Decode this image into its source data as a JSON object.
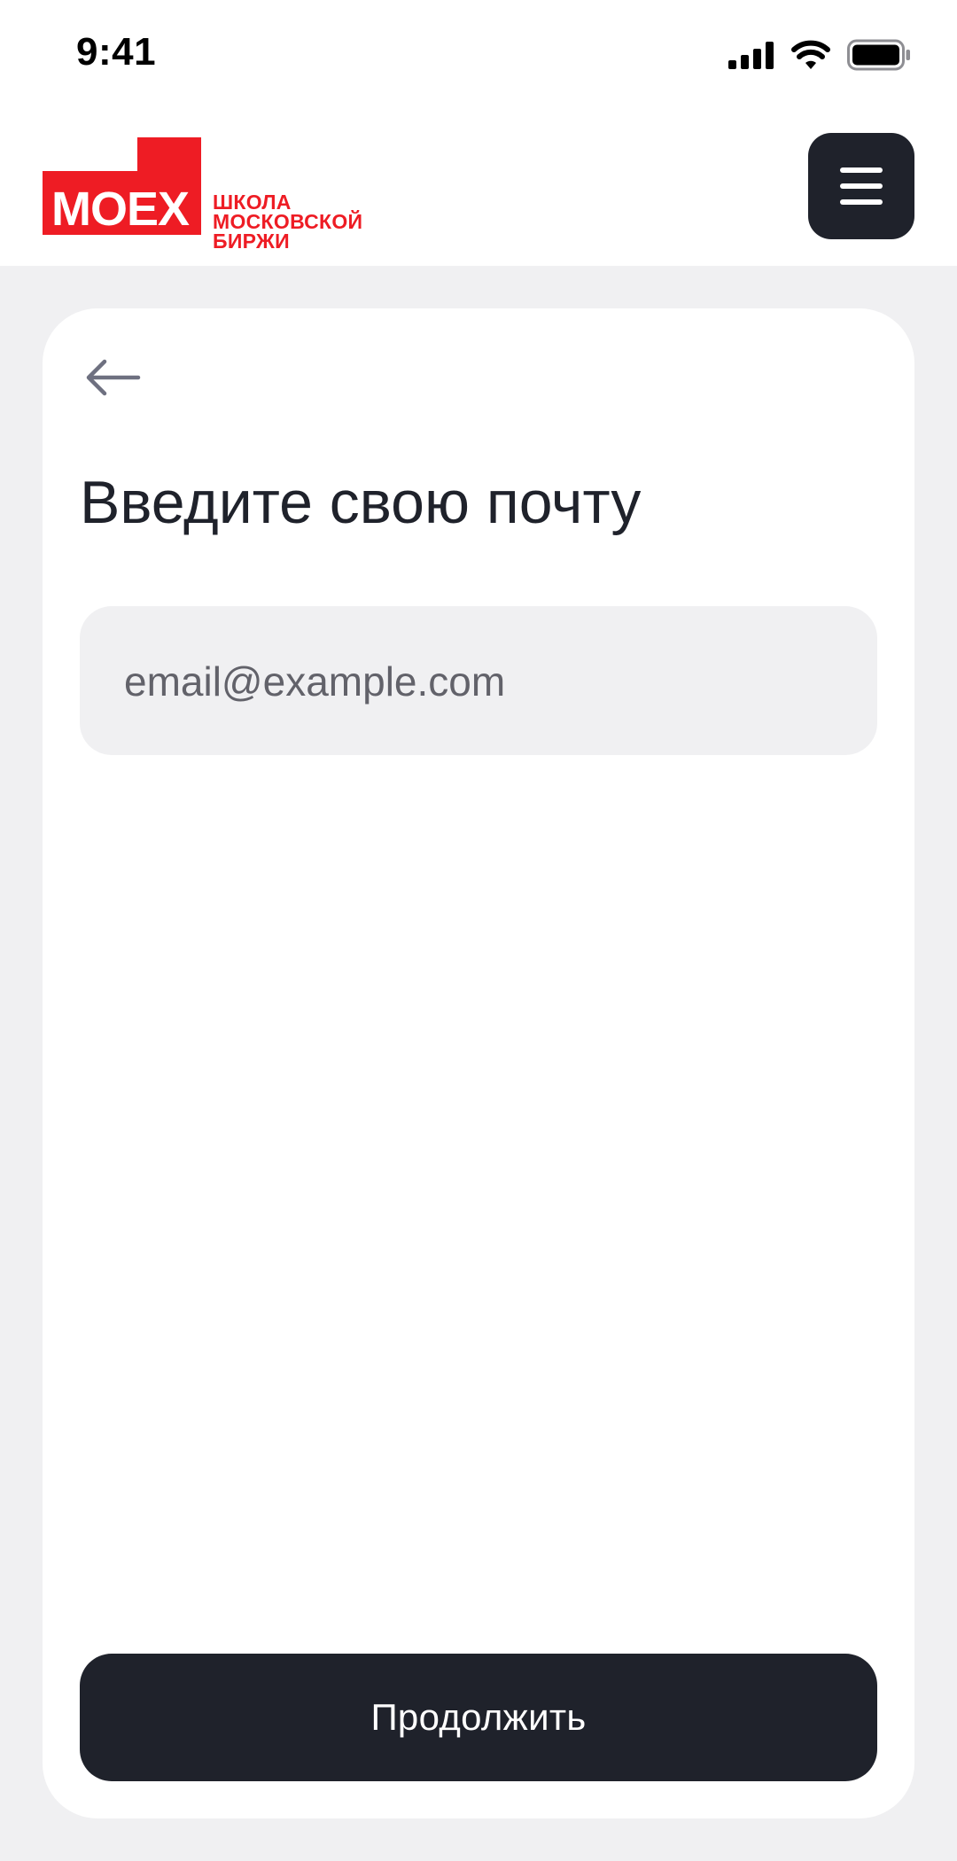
{
  "status_bar": {
    "time": "9:41",
    "icons": [
      "cellular-signal-icon",
      "wifi-icon",
      "battery-icon"
    ]
  },
  "header": {
    "logo": {
      "wordmark": "MOEX",
      "lines": [
        "ШКОЛА",
        "МОСКОВСКОЙ",
        "БИРЖИ"
      ],
      "color": "#ee1c24"
    },
    "menu_icon": "hamburger-menu-icon"
  },
  "card": {
    "back_icon": "arrow-left-icon",
    "title": "Введите свою почту",
    "email": {
      "placeholder": "email@example.com",
      "value": ""
    },
    "continue_label": "Продолжить"
  },
  "colors": {
    "accent": "#ee1c24",
    "dark": "#1f222b",
    "background": "#f0f0f2",
    "surface": "#ffffff"
  }
}
